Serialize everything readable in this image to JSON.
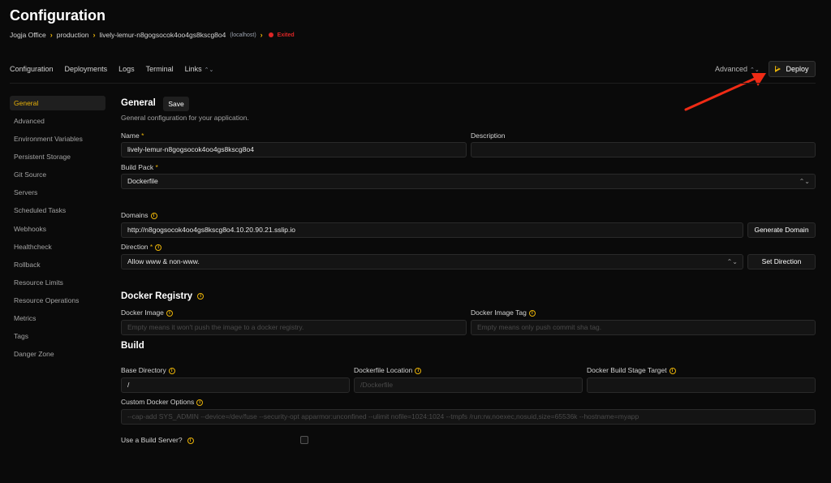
{
  "header": {
    "title": "Configuration",
    "breadcrumb": {
      "team": "Jogja Office",
      "environment": "production",
      "app": "lively-lemur-n8gogsocok4oo4gs8kscg8o4",
      "host": "(localhost)",
      "status": "Exited",
      "status_color": "#dc2626"
    }
  },
  "topnav": {
    "tabs": [
      "Configuration",
      "Deployments",
      "Logs",
      "Terminal",
      "Links"
    ],
    "advanced": "Advanced",
    "deploy": "Deploy"
  },
  "sidebar": {
    "items": [
      "General",
      "Advanced",
      "Environment Variables",
      "Persistent Storage",
      "Git Source",
      "Servers",
      "Scheduled Tasks",
      "Webhooks",
      "Healthcheck",
      "Rollback",
      "Resource Limits",
      "Resource Operations",
      "Metrics",
      "Tags",
      "Danger Zone"
    ],
    "active": "General"
  },
  "general": {
    "title": "General",
    "save": "Save",
    "subtitle": "General configuration for your application.",
    "name_label": "Name",
    "name_value": "lively-lemur-n8gogsocok4oo4gs8kscg8o4",
    "description_label": "Description",
    "description_value": "",
    "buildpack_label": "Build Pack",
    "buildpack_value": "Dockerfile",
    "domains_label": "Domains",
    "domains_value": "http://n8gogsocok4oo4gs8kscg8o4.10.20.90.21.sslip.io",
    "generate_domain": "Generate Domain",
    "direction_label": "Direction",
    "direction_value": "Allow www & non-www.",
    "set_direction": "Set Direction"
  },
  "registry": {
    "title": "Docker Registry",
    "image_label": "Docker Image",
    "image_placeholder": "Empty means it won't push the image to a docker registry.",
    "tag_label": "Docker Image Tag",
    "tag_placeholder": "Empty means only push commit sha tag."
  },
  "build": {
    "title": "Build",
    "base_dir_label": "Base Directory",
    "base_dir_value": "/",
    "dockerfile_label": "Dockerfile Location",
    "dockerfile_placeholder": "/Dockerfile",
    "stage_label": "Docker Build Stage Target",
    "stage_value": "",
    "options_label": "Custom Docker Options",
    "options_placeholder": "--cap-add SYS_ADMIN --device=/dev/fuse --security-opt apparmor:unconfined --ulimit nofile=1024:1024 --tmpfs /run:rw,noexec,nosuid,size=65536k --hostname=myapp",
    "build_server_label": "Use a Build Server?",
    "build_server_checked": false
  },
  "colors": {
    "accent": "#eab308",
    "background": "#0a0a0a",
    "danger": "#dc2626"
  }
}
